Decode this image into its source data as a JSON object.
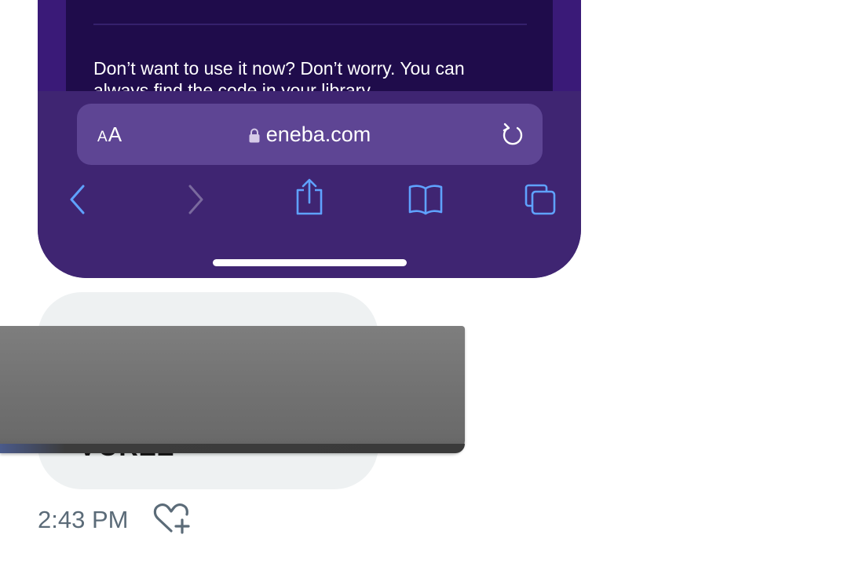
{
  "browser_page": {
    "body_text": "Don’t want to use it now? Don’t worry. You can",
    "body_text_cut": "always find the code in your library."
  },
  "address_bar": {
    "reader_label": "AA",
    "url": "eneba.com"
  },
  "nav": {
    "back_icon": "chevron-left-icon",
    "forward_icon": "chevron-right-icon",
    "share_icon": "share-icon",
    "bookmarks_icon": "book-icon",
    "tabs_icon": "tabs-icon"
  },
  "message": {
    "code_partial": "VCRZZ",
    "time": "2:43 PM",
    "react_icon": "heart-plus-icon"
  },
  "colors": {
    "toolbar": "#3f2572",
    "address_bar": "#5e4594",
    "nav_active": "#5fa2ff",
    "bubble": "#eef1f2",
    "timestamp": "#5b6b78"
  }
}
